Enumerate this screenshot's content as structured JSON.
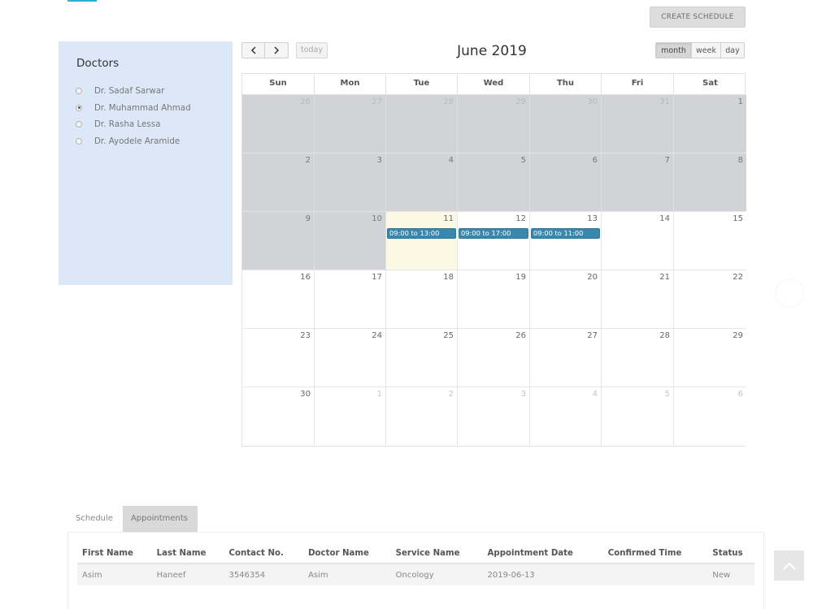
{
  "header": {
    "create_schedule_label": "CREATE SCHEDULE"
  },
  "doctors": {
    "title": "Doctors",
    "items": [
      {
        "label": "Dr. Sadaf Sarwar",
        "checked": false
      },
      {
        "label": "Dr. Muhammad Ahmad",
        "checked": true
      },
      {
        "label": "Dr. Rasha Lessa",
        "checked": false
      },
      {
        "label": "Dr. Ayodele Aramide",
        "checked": false
      }
    ]
  },
  "calendar": {
    "title": "June 2019",
    "prev_icon": "chevron-left-icon",
    "next_icon": "chevron-right-icon",
    "today_label": "today",
    "views": {
      "month": "month",
      "week": "week",
      "day": "day",
      "active": "month"
    },
    "weekdays": [
      "Sun",
      "Mon",
      "Tue",
      "Wed",
      "Thu",
      "Fri",
      "Sat"
    ],
    "weeks": [
      [
        {
          "num": "26",
          "other": true,
          "disabled": true
        },
        {
          "num": "27",
          "other": true,
          "disabled": true
        },
        {
          "num": "28",
          "other": true,
          "disabled": true
        },
        {
          "num": "29",
          "other": true,
          "disabled": true
        },
        {
          "num": "30",
          "other": true,
          "disabled": true
        },
        {
          "num": "31",
          "other": true,
          "disabled": true
        },
        {
          "num": "1",
          "other": false,
          "disabled": true
        }
      ],
      [
        {
          "num": "2",
          "disabled": true
        },
        {
          "num": "3",
          "disabled": true
        },
        {
          "num": "4",
          "disabled": true
        },
        {
          "num": "5",
          "disabled": true
        },
        {
          "num": "6",
          "disabled": true
        },
        {
          "num": "7",
          "disabled": true
        },
        {
          "num": "8",
          "disabled": true
        }
      ],
      [
        {
          "num": "9",
          "disabled": true
        },
        {
          "num": "10",
          "disabled": true
        },
        {
          "num": "11",
          "today": true,
          "event": "09:00 to 13:00"
        },
        {
          "num": "12",
          "event": "09:00 to 17:00"
        },
        {
          "num": "13",
          "event": "09:00 to 11:00"
        },
        {
          "num": "14"
        },
        {
          "num": "15"
        }
      ],
      [
        {
          "num": "16"
        },
        {
          "num": "17"
        },
        {
          "num": "18"
        },
        {
          "num": "19"
        },
        {
          "num": "20"
        },
        {
          "num": "21"
        },
        {
          "num": "22"
        }
      ],
      [
        {
          "num": "23"
        },
        {
          "num": "24"
        },
        {
          "num": "25"
        },
        {
          "num": "26"
        },
        {
          "num": "27"
        },
        {
          "num": "28"
        },
        {
          "num": "29"
        }
      ],
      [
        {
          "num": "30"
        },
        {
          "num": "1",
          "other": true
        },
        {
          "num": "2",
          "other": true
        },
        {
          "num": "3",
          "other": true
        },
        {
          "num": "4",
          "other": true
        },
        {
          "num": "5",
          "other": true
        },
        {
          "num": "6",
          "other": true
        }
      ]
    ],
    "event_color": "#3a87ad",
    "today_color": "#fcf8e3",
    "disabled_color": "#d2d3d6"
  },
  "tabs": {
    "schedule": "Schedule",
    "appointments": "Appointments",
    "active": "appointments"
  },
  "appointments": {
    "columns": [
      "First Name",
      "Last Name",
      "Contact No.",
      "Doctor Name",
      "Service Name",
      "Appointment Date",
      "Confirmed Time",
      "Status"
    ],
    "rows": [
      [
        "Asim",
        "Haneef",
        "3546354",
        "Asim",
        "Oncology",
        "2019-06-13",
        "",
        "New"
      ]
    ]
  },
  "scroll_top_icon": "arrow-up-icon"
}
